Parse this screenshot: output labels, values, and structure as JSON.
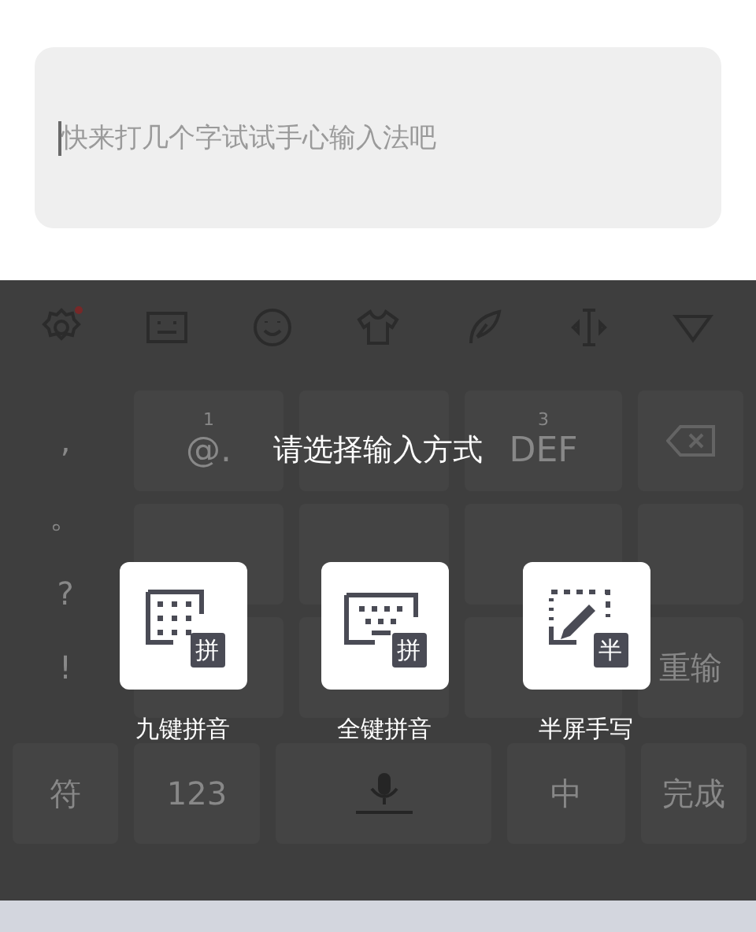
{
  "input": {
    "placeholder": "快来打几个字试试手心输入法吧"
  },
  "keyboard": {
    "toolbar": [
      {
        "kind": "settings",
        "badge": true
      },
      {
        "kind": "keyboard"
      },
      {
        "kind": "emoji"
      },
      {
        "kind": "shirt"
      },
      {
        "kind": "feather"
      },
      {
        "kind": "cursor"
      },
      {
        "kind": "collapse"
      }
    ],
    "punctuation": [
      ",",
      "。",
      "?",
      "!"
    ],
    "rows": [
      [
        {
          "digit": "1",
          "label": "@."
        },
        {},
        {
          "digit": "3",
          "label": "DEF"
        }
      ],
      [
        {},
        {},
        {}
      ],
      [
        {},
        {},
        {}
      ]
    ],
    "side_keys": [
      {
        "kind": "backspace"
      },
      {
        "kind": "blank"
      },
      {
        "kind": "text",
        "label": "重输"
      }
    ],
    "bottom": [
      {
        "kind": "text",
        "label": "符"
      },
      {
        "kind": "text",
        "label": "123"
      },
      {
        "kind": "space"
      },
      {
        "kind": "text",
        "label": "中"
      },
      {
        "kind": "text",
        "label": "完成"
      }
    ]
  },
  "dialog": {
    "title": "请选择输入方式",
    "options": [
      {
        "kind": "nine_key",
        "badge": "拼",
        "label": "九键拼音"
      },
      {
        "kind": "full_key",
        "badge": "拼",
        "label": "全键拼音"
      },
      {
        "kind": "handwriting",
        "badge": "半",
        "label": "半屏手写"
      }
    ]
  }
}
